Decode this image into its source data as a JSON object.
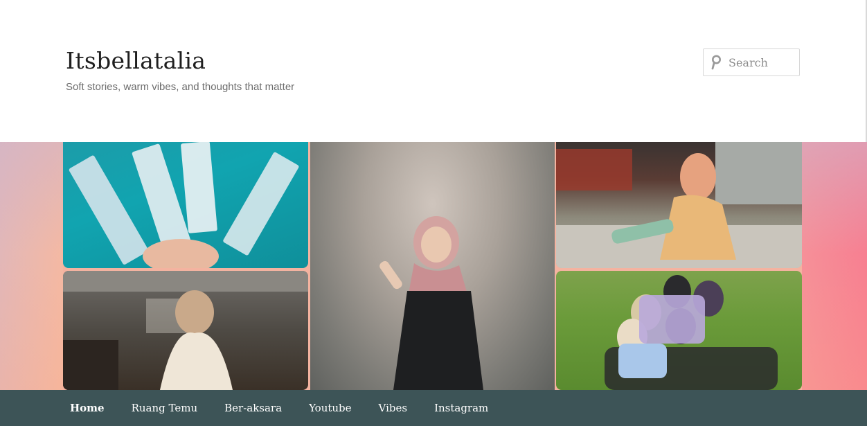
{
  "header": {
    "site_title": "Itsbellatalia",
    "tagline": "Soft stories, warm vibes, and thoughts that matter"
  },
  "search": {
    "placeholder": "Search",
    "value": ""
  },
  "nav": {
    "items": [
      {
        "label": "Home",
        "active": true
      },
      {
        "label": "Ruang Temu",
        "active": false
      },
      {
        "label": "Ber-aksara",
        "active": false
      },
      {
        "label": "Youtube",
        "active": false
      },
      {
        "label": "Vibes",
        "active": false
      },
      {
        "label": "Instagram",
        "active": false
      }
    ]
  },
  "colors": {
    "nav_background": "#3d5457",
    "title_text": "#1f1f1f",
    "tagline_text": "#6d6d6d"
  },
  "icons": {
    "search": "search-icon"
  }
}
